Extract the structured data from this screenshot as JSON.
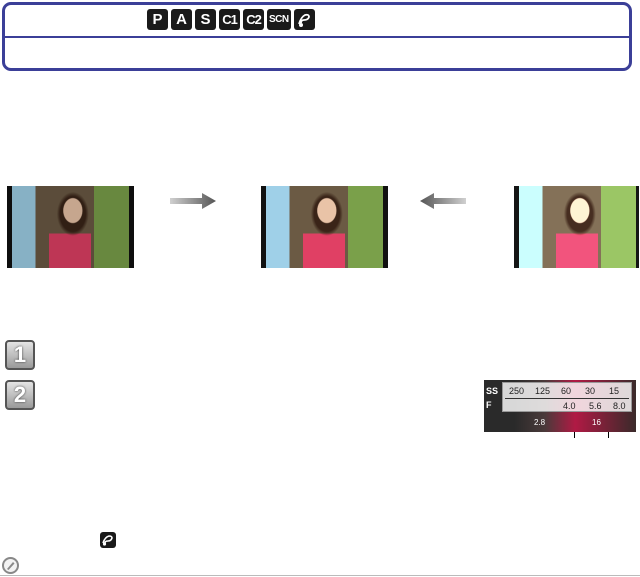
{
  "header": {
    "modes": [
      "P",
      "A",
      "S",
      "C1",
      "C2",
      "SCN",
      "creative-icon"
    ]
  },
  "figure": {
    "photos": [
      "photo-underexposed",
      "photo-correct",
      "photo-overexposed"
    ],
    "arrows": [
      "arrow-right-icon",
      "arrow-left-icon"
    ]
  },
  "steps": [
    {
      "number": "1"
    },
    {
      "number": "2"
    }
  ],
  "meter": {
    "ss_label": "SS",
    "f_label": "F",
    "shutter_values": [
      "250",
      "125",
      "60",
      "30",
      "15"
    ],
    "aperture_values": [
      "4.0",
      "5.6",
      "8.0"
    ],
    "lower_values": [
      "2.8",
      "16"
    ]
  },
  "colors": {
    "header_border": "#3b3f98",
    "mode_badge": "#1a1a1a"
  }
}
